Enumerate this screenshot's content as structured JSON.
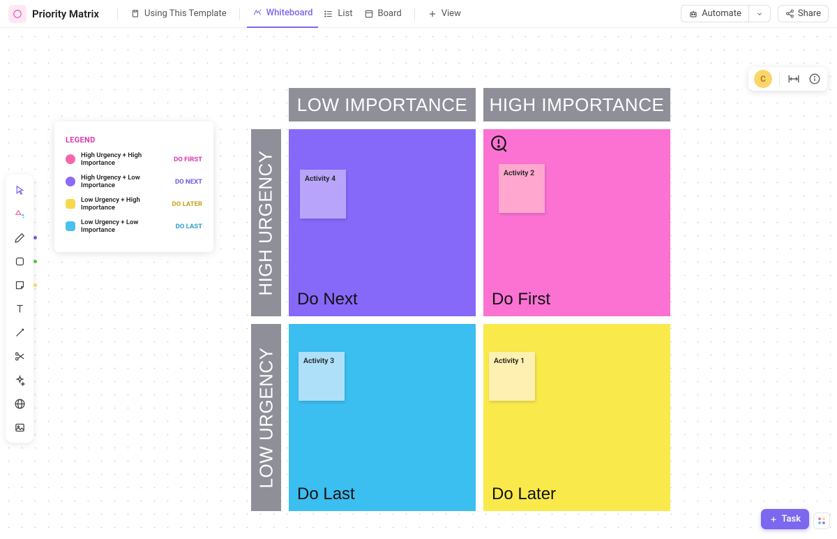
{
  "header": {
    "title": "Priority Matrix",
    "using_template": "Using This Template",
    "tabs": {
      "whiteboard": "Whiteboard",
      "list": "List",
      "board": "Board",
      "view": "View"
    },
    "automate": "Automate",
    "share": "Share"
  },
  "avatar_initial": "C",
  "legend": {
    "title": "LEGEND",
    "items": [
      {
        "color": "#f766a9",
        "label": "High Urgency + High Importance",
        "action": "DO FIRST",
        "action_color": "#d83bb1"
      },
      {
        "color": "#8a6af7",
        "label": "High Urgency + Low Importance",
        "action": "DO NEXT",
        "action_color": "#6b5ce7"
      },
      {
        "color": "#f7d94c",
        "label": "Low Urgency + High Importance",
        "action": "DO LATER",
        "action_color": "#caa21a"
      },
      {
        "color": "#46c2ec",
        "label": "Low Urgency + Low Importance",
        "action": "DO LAST",
        "action_color": "#2aa0cc"
      }
    ]
  },
  "matrix": {
    "col1": "LOW IMPORTANCE",
    "col2": "HIGH IMPORTANCE",
    "row1": "HIGH URGENCY",
    "row2": "LOW URGENCY",
    "quads": {
      "top_left": {
        "bg": "#8769f9",
        "label": "Do Next",
        "sticky_bg": "#b8a5fb",
        "sticky_text": "Activity 4"
      },
      "top_right": {
        "bg": "#fb72d3",
        "label": "Do First",
        "sticky_bg": "#ffa7cf",
        "sticky_text": "Activity 2"
      },
      "bot_left": {
        "bg": "#3bbef0",
        "label": "Do Last",
        "sticky_bg": "#aee0fa",
        "sticky_text": "Activity 3"
      },
      "bot_right": {
        "bg": "#fae94b",
        "label": "Do Later",
        "sticky_bg": "#fdf0b0",
        "sticky_text": "Activity 1"
      }
    }
  },
  "task_button": "Task"
}
